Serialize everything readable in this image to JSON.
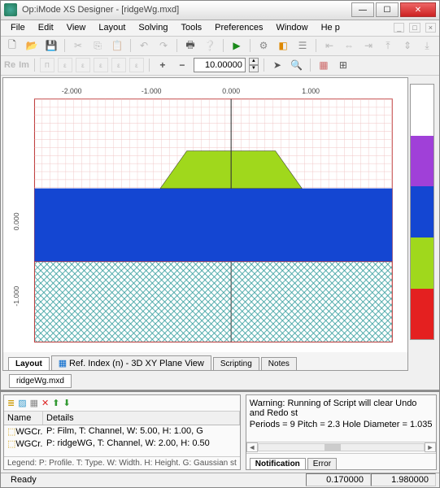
{
  "window": {
    "title": "Op:iMode XS Designer  - [ridgeWg.mxd]"
  },
  "menu": {
    "file": "File",
    "edit": "Edit",
    "view": "View",
    "layout": "Layout",
    "solving": "Solving",
    "tools": "Tools",
    "preferences": "Preferences",
    "window": "Window",
    "help": "He p"
  },
  "numfield": {
    "value": "10.00000"
  },
  "reim": {
    "re": "Re",
    "im": "Im"
  },
  "tabs": {
    "layout": "Layout",
    "refindex": "Ref. Index (n) - 3D XY Plane View",
    "scripting": "Scripting",
    "notes": "Notes"
  },
  "filetab": "ridgeWg.mxd",
  "ruler": {
    "xticks": [
      "-2.000",
      "-1.000",
      "0.000",
      "1.000"
    ],
    "yticks": [
      "-1.000",
      "0.000"
    ]
  },
  "list": {
    "headers": {
      "name": "Name",
      "details": "Details"
    },
    "rows": [
      {
        "name": "WGCr...",
        "details": "P: Film, T: Channel, W: 5.00, H: 1.00, G"
      },
      {
        "name": "WGCr...",
        "details": "P: ridgeWG, T: Channel, W: 2.00, H: 0.50"
      }
    ],
    "legend": "Legend: P: Profile. T: Type. W: Width. H: Height. G: Gaussian st"
  },
  "messages": {
    "line1": "Warning: Running of Script will clear Undo and Redo st",
    "line2": "Periods = 9   Pitch = 2.3   Hole Diameter = 1.035",
    "tabs": {
      "notification": "Notification",
      "error": "Error"
    }
  },
  "status": {
    "ready": "Ready",
    "x": "0.170000",
    "y": "1.980000"
  },
  "colors": {
    "purple": "#a040d8",
    "blue": "#1446d2",
    "green": "#a0d81c",
    "red": "#e42020",
    "white": "#ffffff",
    "grid": "#e8b0b0",
    "hatch": "#6ab8b8"
  },
  "chart_data": {
    "type": "area",
    "title": "",
    "xlabel": "",
    "ylabel": "",
    "xlim": [
      -2.5,
      2.5
    ],
    "ylim": [
      -1.3,
      1.0
    ],
    "regions": [
      {
        "name": "air-grid-top",
        "color": "#e8b0b0",
        "y": [
          0.5,
          1.0
        ]
      },
      {
        "name": "ridge-trapezoid",
        "color": "#a0d81c",
        "points": [
          [
            -1.0,
            0.0
          ],
          [
            -0.5,
            0.5
          ],
          [
            0.5,
            0.5
          ],
          [
            1.0,
            0.0
          ]
        ]
      },
      {
        "name": "film",
        "color": "#1446d2",
        "y": [
          -0.5,
          0.0
        ]
      },
      {
        "name": "substrate-hatch",
        "color": "#6ab8b8",
        "y": [
          -1.3,
          -0.5
        ]
      }
    ]
  }
}
